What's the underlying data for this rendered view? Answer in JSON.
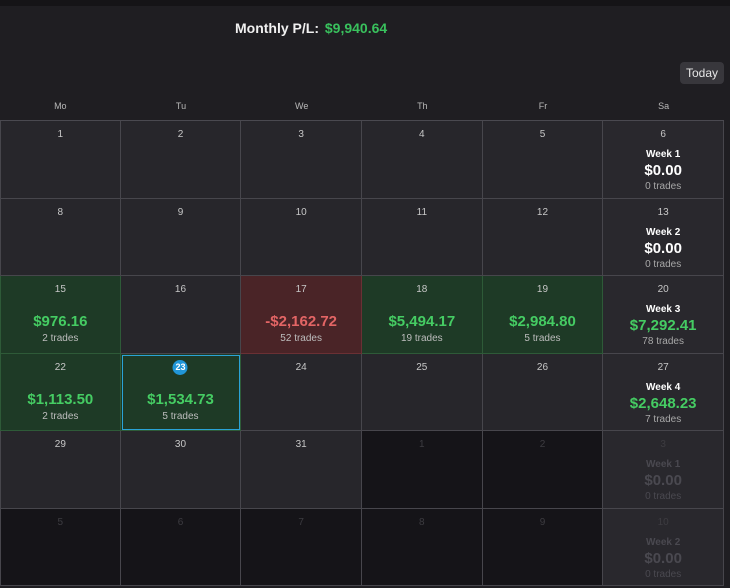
{
  "header": {
    "label": "Monthly P/L:",
    "value": "$9,940.64"
  },
  "today_button": "Today",
  "weekdays": [
    "Mo",
    "Tu",
    "We",
    "Th",
    "Fr",
    "Sa"
  ],
  "colors": {
    "positive": "#45cc63",
    "negative": "#e36565",
    "selected": "#2aa3d6"
  },
  "rows": [
    {
      "days": [
        {
          "num": "1",
          "pl": "",
          "trades": "",
          "state": "normal"
        },
        {
          "num": "2",
          "pl": "",
          "trades": "",
          "state": "normal"
        },
        {
          "num": "3",
          "pl": "",
          "trades": "",
          "state": "normal"
        },
        {
          "num": "4",
          "pl": "",
          "trades": "",
          "state": "normal"
        },
        {
          "num": "5",
          "pl": "",
          "trades": "",
          "state": "normal"
        }
      ],
      "week": {
        "num": "6",
        "label": "Week 1",
        "amount": "$0.00",
        "trades": "0 trades",
        "tone": "white",
        "state": "normal"
      }
    },
    {
      "days": [
        {
          "num": "8",
          "pl": "",
          "trades": "",
          "state": "normal"
        },
        {
          "num": "9",
          "pl": "",
          "trades": "",
          "state": "normal"
        },
        {
          "num": "10",
          "pl": "",
          "trades": "",
          "state": "normal"
        },
        {
          "num": "11",
          "pl": "",
          "trades": "",
          "state": "normal"
        },
        {
          "num": "12",
          "pl": "",
          "trades": "",
          "state": "normal"
        }
      ],
      "week": {
        "num": "13",
        "label": "Week 2",
        "amount": "$0.00",
        "trades": "0 trades",
        "tone": "white",
        "state": "normal"
      }
    },
    {
      "days": [
        {
          "num": "15",
          "pl": "$976.16",
          "trades": "2 trades",
          "state": "pos"
        },
        {
          "num": "16",
          "pl": "",
          "trades": "",
          "state": "normal"
        },
        {
          "num": "17",
          "pl": "-$2,162.72",
          "trades": "52 trades",
          "state": "neg"
        },
        {
          "num": "18",
          "pl": "$5,494.17",
          "trades": "19 trades",
          "state": "pos"
        },
        {
          "num": "19",
          "pl": "$2,984.80",
          "trades": "5 trades",
          "state": "pos"
        }
      ],
      "week": {
        "num": "20",
        "label": "Week 3",
        "amount": "$7,292.41",
        "trades": "78 trades",
        "tone": "green",
        "state": "normal"
      }
    },
    {
      "days": [
        {
          "num": "22",
          "pl": "$1,113.50",
          "trades": "2 trades",
          "state": "pos"
        },
        {
          "num": "23",
          "pl": "$1,534.73",
          "trades": "5 trades",
          "state": "pos",
          "selected": true
        },
        {
          "num": "24",
          "pl": "",
          "trades": "",
          "state": "normal"
        },
        {
          "num": "25",
          "pl": "",
          "trades": "",
          "state": "normal"
        },
        {
          "num": "26",
          "pl": "",
          "trades": "",
          "state": "normal"
        }
      ],
      "week": {
        "num": "27",
        "label": "Week 4",
        "amount": "$2,648.23",
        "trades": "7 trades",
        "tone": "green",
        "state": "normal"
      }
    },
    {
      "days": [
        {
          "num": "29",
          "pl": "",
          "trades": "",
          "state": "normal"
        },
        {
          "num": "30",
          "pl": "",
          "trades": "",
          "state": "normal"
        },
        {
          "num": "31",
          "pl": "",
          "trades": "",
          "state": "normal"
        },
        {
          "num": "1",
          "pl": "",
          "trades": "",
          "state": "dim"
        },
        {
          "num": "2",
          "pl": "",
          "trades": "",
          "state": "dim"
        }
      ],
      "week": {
        "num": "3",
        "label": "Week 1",
        "amount": "$0.00",
        "trades": "0 trades",
        "tone": "white",
        "state": "dim"
      }
    },
    {
      "days": [
        {
          "num": "5",
          "pl": "",
          "trades": "",
          "state": "dim"
        },
        {
          "num": "6",
          "pl": "",
          "trades": "",
          "state": "dim"
        },
        {
          "num": "7",
          "pl": "",
          "trades": "",
          "state": "dim"
        },
        {
          "num": "8",
          "pl": "",
          "trades": "",
          "state": "dim"
        },
        {
          "num": "9",
          "pl": "",
          "trades": "",
          "state": "dim"
        }
      ],
      "week": {
        "num": "10",
        "label": "Week 2",
        "amount": "$0.00",
        "trades": "0 trades",
        "tone": "white",
        "state": "dim"
      }
    }
  ]
}
